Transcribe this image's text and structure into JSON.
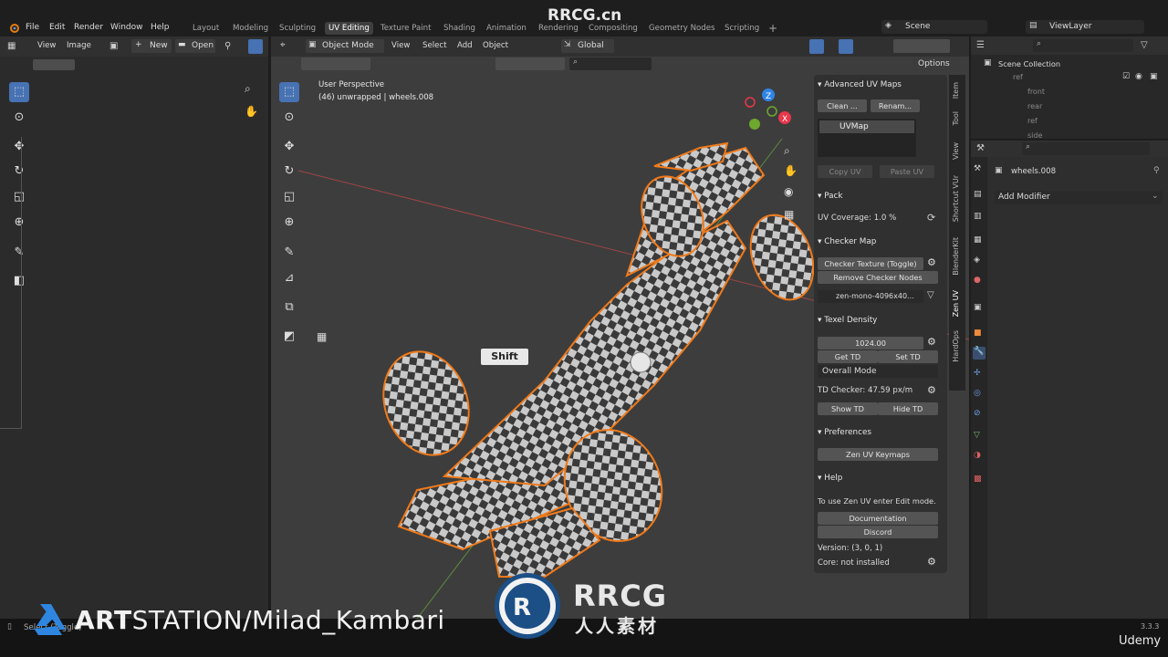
{
  "watermark_top": "RRCG.cn",
  "menu": [
    "File",
    "Edit",
    "Render",
    "Window",
    "Help"
  ],
  "workspaces": [
    "Layout",
    "Modeling",
    "Sculpting",
    "UV Editing",
    "Texture Paint",
    "Shading",
    "Animation",
    "Rendering",
    "Compositing",
    "Geometry Nodes",
    "Scripting"
  ],
  "active_workspace": "UV Editing",
  "scene": "Scene",
  "view_layer": "ViewLayer",
  "uv_header": {
    "view": "View",
    "image": "Image",
    "new": "New",
    "open": "Open"
  },
  "vp_header": {
    "mode": "Object Mode",
    "view": "View",
    "select": "Select",
    "add": "Add",
    "object": "Object",
    "orientation": "Global",
    "options": "Options"
  },
  "viewport_info": {
    "perspective": "User Perspective",
    "object": "(46) unwrapped | wheels.008"
  },
  "key_overlay": "Shift",
  "npanel": {
    "uv_maps": {
      "title": "Advanced UV Maps",
      "clean": "Clean ...",
      "rename": "Renam...",
      "uvmap": "UVMap",
      "copy": "Copy UV",
      "paste": "Paste UV"
    },
    "pack": {
      "title": "Pack",
      "coverage": "UV Coverage: 1.0 %"
    },
    "checker": {
      "title": "Checker Map",
      "toggle": "Checker Texture (Toggle)",
      "remove": "Remove Checker Nodes",
      "image": "zen-mono-4096x40..."
    },
    "texel": {
      "title": "Texel Density",
      "value": "1024.00",
      "get": "Get TD",
      "set": "Set TD",
      "mode": "Overall Mode",
      "checker": "TD Checker: 47.59 px/m",
      "show": "Show TD",
      "hide": "Hide TD"
    },
    "prefs": {
      "title": "Preferences",
      "keymaps": "Zen UV Keymaps"
    },
    "help": {
      "title": "Help",
      "text": "To use Zen UV enter Edit mode.",
      "docs": "Documentation",
      "discord": "Discord",
      "version": "Version: (3, 0, 1)",
      "core": "Core: not installed"
    }
  },
  "ntabs": [
    "Item",
    "Tool",
    "View",
    "Shortcut VUr",
    "BlenderKit",
    "Zen UV",
    "HardOps"
  ],
  "outliner": {
    "collection": "Scene Collection",
    "items": [
      "ref",
      "front",
      "rear",
      "ref",
      "side"
    ]
  },
  "properties": {
    "object": "wheels.008",
    "add_modifier": "Add Modifier"
  },
  "status": {
    "hint": "Select (Toggle)",
    "version": "3.3.3",
    "brand": "Udemy"
  },
  "artstation": {
    "bold": "ART",
    "rest": "STATION/Milad_Kambari"
  },
  "watermark_logo": {
    "top": "RRCG",
    "bottom": "人人素材"
  },
  "colors": {
    "accent": "#4772b3",
    "selection": "#f07a1a",
    "bg": "#3d3d3d"
  }
}
